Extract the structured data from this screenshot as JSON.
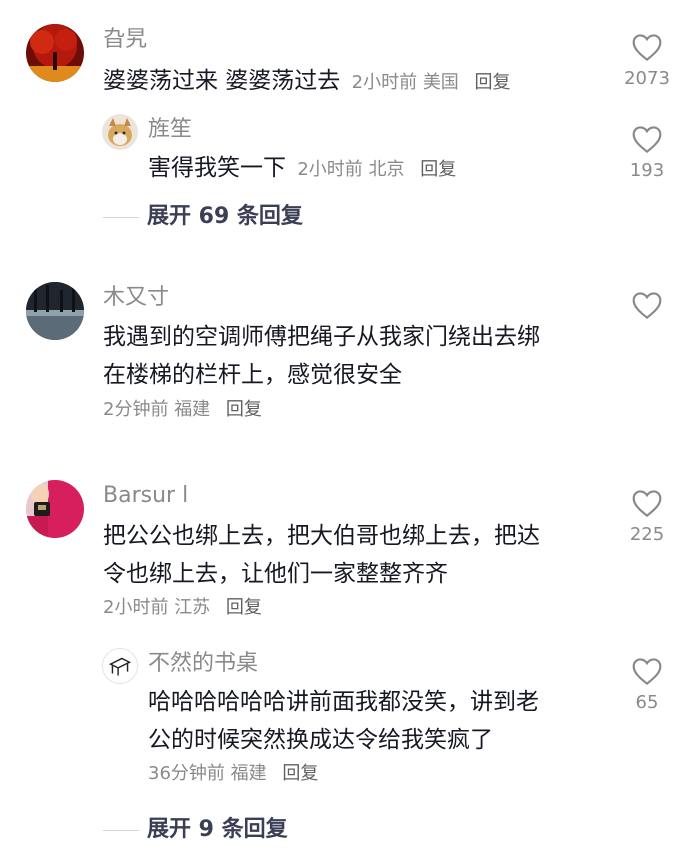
{
  "comments": [
    {
      "user": "旮旯",
      "text": [
        "婆婆荡过来 婆婆荡过去"
      ],
      "time": "2小时前",
      "location": "美国",
      "reply_label": "回复",
      "likes": "2073",
      "reply": {
        "user": "旌笙",
        "text": [
          "害得我笑一下"
        ],
        "time": "2小时前",
        "location": "北京",
        "reply_label": "回复",
        "likes": "193"
      },
      "expand_label": "展开 69 条回复"
    },
    {
      "user": "木又寸",
      "text": [
        "我遇到的空调师傅把绳子从我家门绕出去绑",
        "在楼梯的栏杆上，感觉很安全"
      ],
      "time": "2分钟前",
      "location": "福建",
      "reply_label": "回复",
      "likes": ""
    },
    {
      "user": "Barsur l",
      "text": [
        "把公公也绑上去，把大伯哥也绑上去，把达",
        "令也绑上去，让他们一家整整齐齐"
      ],
      "time": "2小时前",
      "location": "江苏",
      "reply_label": "回复",
      "likes": "225",
      "reply": {
        "user": "不然的书桌",
        "text": [
          "哈哈哈哈哈哈讲前面我都没笑，讲到老",
          "公的时候突然换成达令给我笑疯了"
        ],
        "time": "36分钟前",
        "location": "福建",
        "reply_label": "回复",
        "likes": "65"
      },
      "expand_label": "展开 9 条回复"
    }
  ],
  "icons": {
    "like": "heart-outline-icon"
  },
  "colors": {
    "username": "#8a8a8a",
    "content": "#161823",
    "meta": "#8a8a8a",
    "expand": "#3a3f56"
  }
}
